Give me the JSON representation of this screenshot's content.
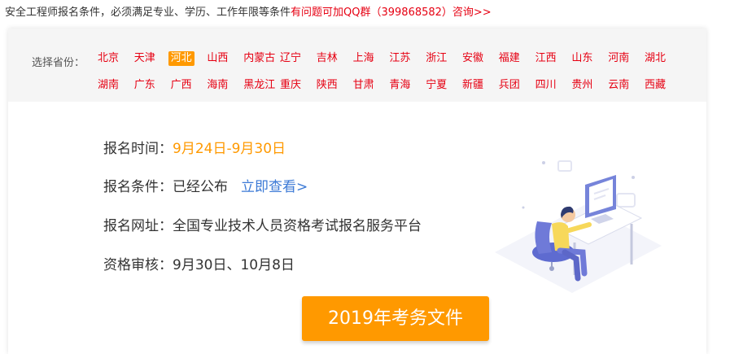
{
  "top_line": {
    "text": "安全工程师报名条件，必须满足专业、学历、工作年限等条件",
    "link": "有问题可加QQ群（399868582）咨询>>"
  },
  "provinces": {
    "label": "选择省份：",
    "row1": [
      "北京",
      "天津",
      "河北",
      "山西",
      "内蒙古",
      "辽宁",
      "吉林",
      "上海",
      "江苏",
      "浙江",
      "安徽",
      "福建",
      "江西",
      "山东",
      "河南",
      "湖北"
    ],
    "row2": [
      "湖南",
      "广东",
      "广西",
      "海南",
      "黑龙江",
      "重庆",
      "陕西",
      "甘肃",
      "青海",
      "宁夏",
      "新疆",
      "兵团",
      "四川",
      "贵州",
      "云南",
      "西藏"
    ],
    "selected": "河北"
  },
  "info": {
    "time": {
      "label": "报名时间：",
      "value": "9月24日-9月30日"
    },
    "condition": {
      "label": "报名条件：",
      "value": "已经公布",
      "link": "立即查看>"
    },
    "website": {
      "label": "报名网址：",
      "value": "全国专业技术人员资格考试报名服务平台"
    },
    "review": {
      "label": "资格审核：",
      "value": "9月30日、10月8日"
    }
  },
  "cta": {
    "label": "2019年考务文件"
  },
  "colors": {
    "accent": "#ff9900",
    "red": "#e60012",
    "link_blue": "#3c7ad6",
    "illustration_blue": "#6677d6"
  }
}
